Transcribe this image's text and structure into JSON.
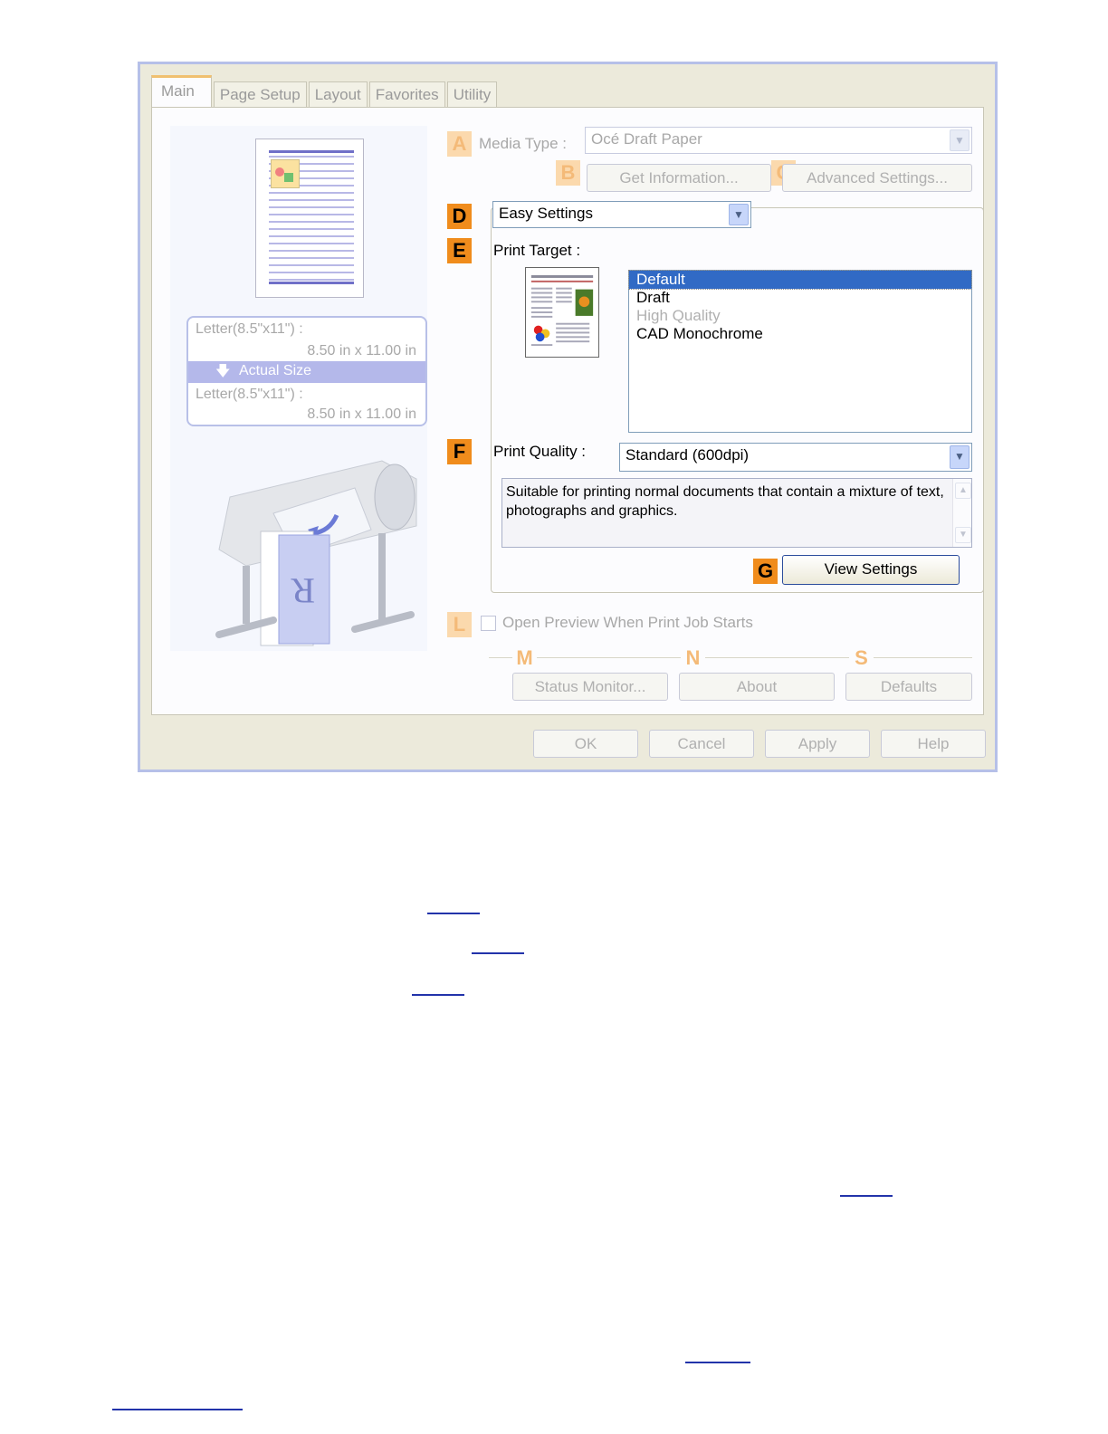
{
  "dialog": {
    "tabs": [
      "Main",
      "Page Setup",
      "Layout",
      "Favorites",
      "Utility"
    ],
    "active_tab": "Main",
    "preview": {
      "size_top_label": "Letter(8.5\"x11\") :",
      "size_top_value": "8.50 in x 11.00 in",
      "scaling_label": "Actual Size",
      "size_bottom_label": "Letter(8.5\"x11\") :",
      "size_bottom_value": "8.50 in x 11.00 in"
    },
    "badges": {
      "a": "A",
      "b": "B",
      "c": "C",
      "d": "D",
      "e": "E",
      "f": "F",
      "g": "G",
      "l": "L",
      "m": "M",
      "n": "N",
      "s": "S"
    },
    "media_type_label": "Media Type :",
    "media_type_value": "Océ Draft Paper",
    "get_information_label": "Get Information...",
    "advanced_settings_label": "Advanced Settings...",
    "settings_mode_value": "Easy Settings",
    "print_target_label": "Print Target :",
    "print_target_items": [
      {
        "label": "Default",
        "selected": true,
        "enabled": true
      },
      {
        "label": "Draft",
        "selected": false,
        "enabled": true
      },
      {
        "label": "High Quality",
        "selected": false,
        "enabled": false
      },
      {
        "label": "CAD Monochrome",
        "selected": false,
        "enabled": true
      }
    ],
    "print_quality_label": "Print Quality :",
    "print_quality_value": "Standard (600dpi)",
    "description": "Suitable for printing normal documents that contain a mixture of text, photographs and graphics.",
    "view_settings_label": "View Settings",
    "open_preview_label": "Open Preview When Print Job Starts",
    "status_monitor_label": "Status Monitor...",
    "about_label": "About",
    "defaults_label": "Defaults",
    "ok_label": "OK",
    "cancel_label": "Cancel",
    "apply_label": "Apply",
    "help_label": "Help"
  },
  "colors": {
    "badge_active": "#f08c1c",
    "badge_dim": "#fbd9ad",
    "selection": "#316ac5",
    "frame": "#b6c0e8"
  }
}
